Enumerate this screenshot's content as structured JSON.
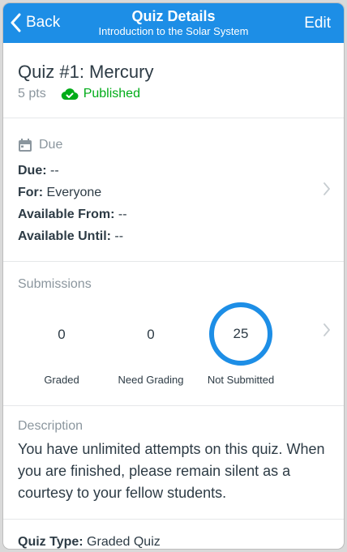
{
  "navbar": {
    "back_label": "Back",
    "title": "Quiz Details",
    "subtitle": "Introduction to the Solar System",
    "edit_label": "Edit"
  },
  "quiz": {
    "title": "Quiz #1: Mercury",
    "points": "5 pts",
    "status": "Published"
  },
  "due_section": {
    "heading": "Due",
    "rows": [
      {
        "label": "Due:",
        "value": " --"
      },
      {
        "label": "For:",
        "value": " Everyone"
      },
      {
        "label": "Available From:",
        "value": " --"
      },
      {
        "label": "Available Until:",
        "value": " --"
      }
    ]
  },
  "submissions": {
    "heading": "Submissions",
    "stats": [
      {
        "value": "0",
        "label": "Graded"
      },
      {
        "value": "0",
        "label": "Need Grading"
      },
      {
        "value": "25",
        "label": "Not Submitted"
      }
    ]
  },
  "description": {
    "heading": "Description",
    "text": "You have unlimited attempts on this quiz. When you are finished, please remain silent as a courtesy to your fellow students."
  },
  "details": {
    "quiz_type_label": "Quiz Type:",
    "quiz_type_value": " Graded Quiz"
  },
  "colors": {
    "accent": "#1d8ee6",
    "published": "#00ac18",
    "muted": "#8b969e",
    "text": "#2d3b45"
  },
  "icons": [
    "chevron-left-icon",
    "cloud-check-icon",
    "calendar-icon",
    "chevron-right-icon"
  ]
}
